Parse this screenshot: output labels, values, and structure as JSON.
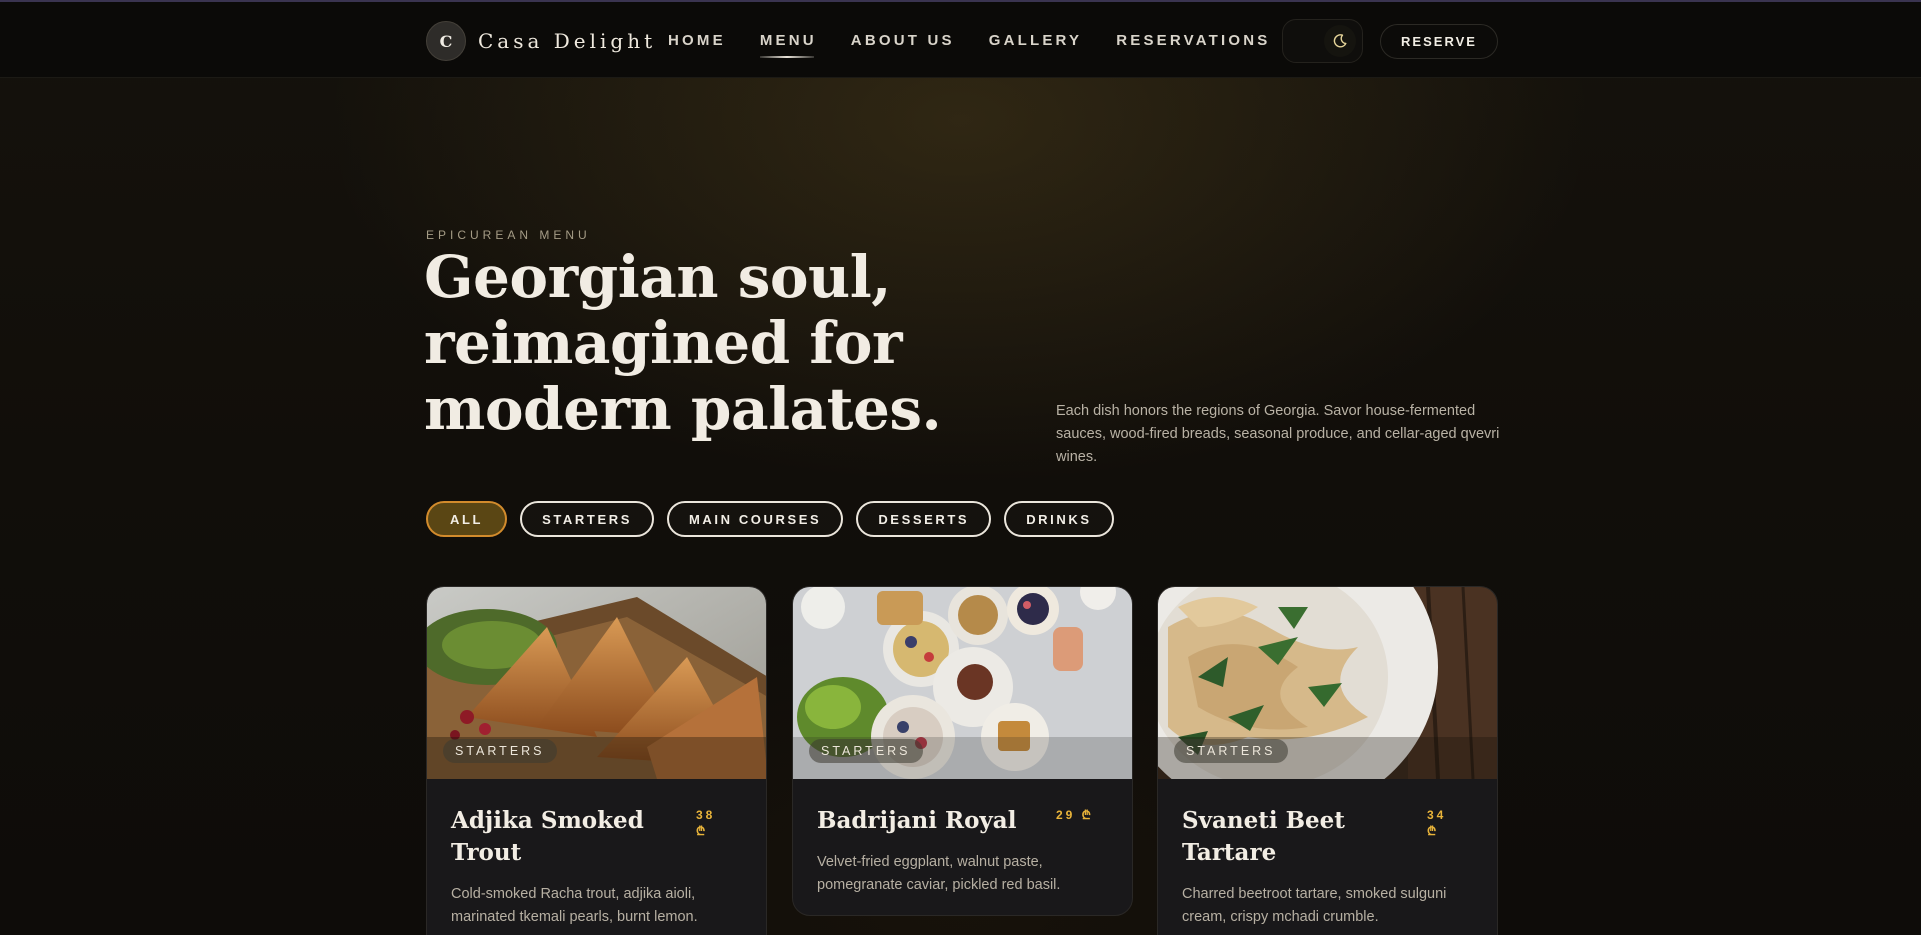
{
  "brand": {
    "mark": "C",
    "name": "Casa Delight"
  },
  "nav": {
    "links": [
      {
        "label": "HOME"
      },
      {
        "label": "MENU",
        "active": true
      },
      {
        "label": "ABOUT US"
      },
      {
        "label": "GALLERY"
      },
      {
        "label": "RESERVATIONS"
      }
    ],
    "theme_icon": "moon-icon",
    "reserve_label": "RESERVE"
  },
  "hero": {
    "eyebrow": "EPICUREAN MENU",
    "title_lines": [
      "Georgian soul,",
      "reimagined for",
      "modern palates."
    ],
    "description": "Each dish honors the regions of Georgia. Savor house-fermented sauces, wood-fired breads, seasonal produce, and cellar-aged qvevri wines."
  },
  "filters": [
    {
      "label": "ALL",
      "active": true
    },
    {
      "label": "STARTERS"
    },
    {
      "label": "MAIN COURSES"
    },
    {
      "label": "DESSERTS"
    },
    {
      "label": "DRINKS"
    }
  ],
  "cards": [
    {
      "tag": "STARTERS",
      "title": "Adjika Smoked Trout",
      "price": "38 ₾",
      "description": "Cold-smoked Racha trout, adjika aioli, marinated tkemali pearls, burnt lemon.",
      "image": "samosa-photo"
    },
    {
      "tag": "STARTERS",
      "title": "Badrijani Royal",
      "price": "29 ₾",
      "description": "Velvet-fried eggplant, walnut paste, pomegranate caviar, pickled red basil.",
      "image": "brunch-table-photo"
    },
    {
      "tag": "STARTERS",
      "title": "Svaneti Beet Tartare",
      "price": "34 ₾",
      "description": "Charred beetroot tartare, smoked sulguni cream, crispy mchadi crumble.",
      "image": "pasta-plate-photo"
    }
  ],
  "colors": {
    "accent_gold": "#e9b43a",
    "active_chip_bg": "#5a4614",
    "active_chip_border": "#d28b2c",
    "background": "#110e0a"
  }
}
